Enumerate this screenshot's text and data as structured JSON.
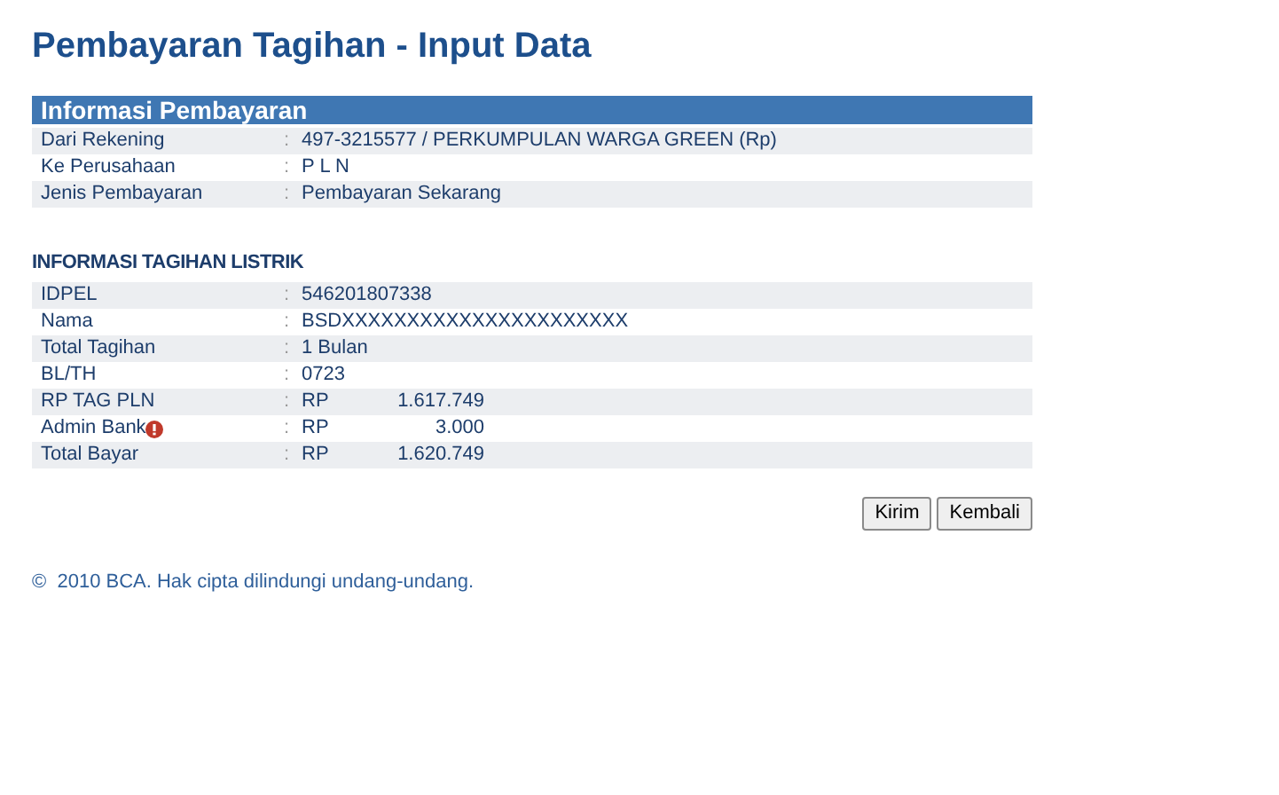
{
  "title": "Pembayaran Tagihan - Input Data",
  "payment_info": {
    "header": "Informasi Pembayaran",
    "rows": [
      {
        "kind": "text",
        "label": "Dari Rekening",
        "sep": ":",
        "value": "497-3215577 / PERKUMPULAN WARGA GREEN (Rp)"
      },
      {
        "kind": "text",
        "label": "Ke Perusahaan",
        "sep": ":",
        "value": "P L N"
      },
      {
        "kind": "text",
        "label": "Jenis Pembayaran",
        "sep": ":",
        "value": "Pembayaran Sekarang"
      }
    ]
  },
  "bill_info": {
    "header": "INFORMASI TAGIHAN LISTRIK",
    "rows": [
      {
        "kind": "text",
        "label": "IDPEL",
        "sep": ":",
        "value": "546201807338"
      },
      {
        "kind": "text",
        "label": "Nama",
        "sep": ":",
        "value": "BSDXXXXXXXXXXXXXXXXXXXXXX"
      },
      {
        "kind": "text",
        "label": "Total Tagihan",
        "sep": ":",
        "value": "1 Bulan"
      },
      {
        "kind": "text",
        "label": "BL/TH",
        "sep": ":",
        "value": "0723"
      },
      {
        "kind": "amount",
        "label": "RP TAG PLN",
        "sep": ":",
        "currency": "RP",
        "value": "1.617.749"
      },
      {
        "kind": "amount",
        "label": "Admin Bank",
        "info": true,
        "sep": ":",
        "currency": "RP",
        "value": "3.000"
      },
      {
        "kind": "amount",
        "label": "Total Bayar",
        "sep": ":",
        "currency": "RP",
        "value": "1.620.749"
      }
    ]
  },
  "buttons": [
    "Kirim",
    "Kembali"
  ],
  "footer": "©  2010 BCA. Hak cipta dilindungi undang-undang."
}
